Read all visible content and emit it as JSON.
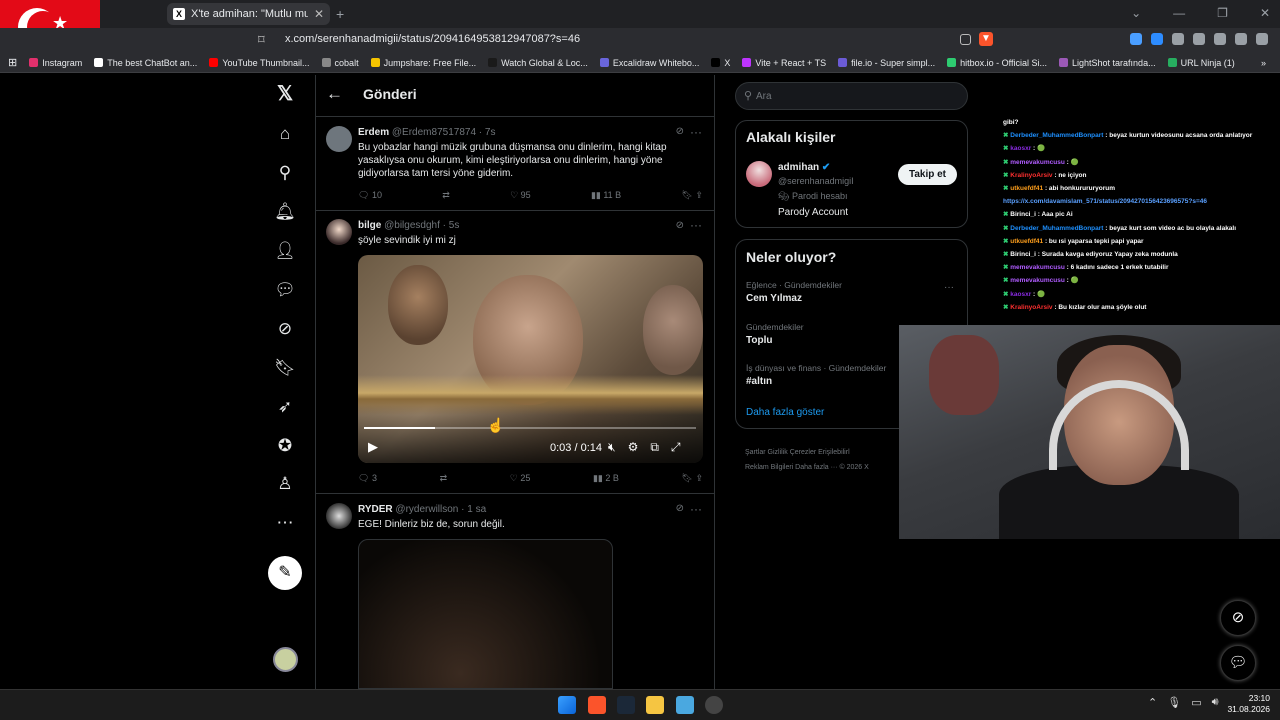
{
  "browser": {
    "tab_title": "X'te admihan: \"Mutlu musunuz i",
    "tab_close": "✕",
    "new_tab": "+",
    "window_controls": [
      "⌄",
      "—",
      "❐",
      "✕"
    ],
    "url": "x.com/serenhanadmigii/status/2094164953812947087?s=46",
    "bookmarks": [
      {
        "label": "Instagram",
        "color": "#e1306c"
      },
      {
        "label": "The best ChatBot an...",
        "color": "#ffffff"
      },
      {
        "label": "YouTube Thumbnail...",
        "color": "#ff0000"
      },
      {
        "label": "cobalt",
        "color": "#888888"
      },
      {
        "label": "Jumpshare: Free File...",
        "color": "#f5c400"
      },
      {
        "label": "Watch Global & Loc...",
        "color": "#1a1a1a"
      },
      {
        "label": "Excalidraw Whitebo...",
        "color": "#6965db"
      },
      {
        "label": "X",
        "color": "#000000"
      },
      {
        "label": "Vite + React + TS",
        "color": "#bd34fe"
      },
      {
        "label": "file.io - Super simpl...",
        "color": "#6b5bd6"
      },
      {
        "label": "hitbox.io - Official Si...",
        "color": "#2ecc71"
      },
      {
        "label": "LightShot tarafında...",
        "color": "#9b59b6"
      },
      {
        "label": "URL Ninja (1)",
        "color": "#27ae60"
      }
    ]
  },
  "header": {
    "back_icon": "←",
    "title": "Gönderi"
  },
  "nav_icons": [
    "x-logo-icon",
    "home-icon",
    "search-icon",
    "notifications-icon",
    "follow-icon",
    "messages-icon",
    "grok-icon",
    "bookmarks-icon",
    "premium-icon",
    "verified-icon",
    "profile-icon",
    "more-icon"
  ],
  "tweets": [
    {
      "name": "Erdem",
      "handle": "@Erdem87517874 · 7s",
      "text": "Bu yobazlar hangi müzik grubuna düşmansa onu dinlerim, hangi kitap yasaklıysa onu okurum, kimi eleştiriyorlarsa onu dinlerim, hangi yöne gidiyorlarsa tam tersi yöne giderim.",
      "replies": "10",
      "reposts": "",
      "likes": "95",
      "views": "11 B"
    },
    {
      "name": "bilge",
      "handle": "@bilgesdghf · 5s",
      "text": "şöyle sevindik iyi mi zj",
      "video": {
        "time": "0:03 / 0:14",
        "progress": 0.214
      },
      "replies": "3",
      "reposts": "",
      "likes": "25",
      "views": "2 B"
    },
    {
      "name": "RYDER",
      "handle": "@ryderwillson · 1 sa",
      "text": "EGE! Dinleriz biz de, sorun değil."
    }
  ],
  "right": {
    "search_placeholder": "Ara",
    "related_title": "Alakalı kişiler",
    "person_name": "admihan",
    "person_handle": "@serenhanadmigiI",
    "parody_label": "Parodi hesabı",
    "parody_account": "Parody Account",
    "follow_label": "Takip et",
    "trends_title": "Neler oluyor?",
    "trends": [
      {
        "category": "Eğlence · Gündemdekiler",
        "name": "Cem Yılmaz"
      },
      {
        "category": "Gündemdekiler",
        "name": "Toplu"
      },
      {
        "category": "İş dünyası ve finans · Gündemdekiler",
        "name": "#altın"
      }
    ],
    "show_more": "Daha fazla göster",
    "footer_line1": "Şartlar    Gizlilik    Çerezler    Erişilebilirl",
    "footer_line2": "Reklam Bilgileri    Daha fazla ···    © 2026 X"
  },
  "chat": [
    {
      "user": "",
      "color": "#ffffff",
      "msg": "gibi?"
    },
    {
      "user": "Derbeder_MuhammedBonpart",
      "color": "#1e90ff",
      "msg": " : beyaz kurtun videosunu acsana orda anlatıyor"
    },
    {
      "user": "kaosxr",
      "color": "#8a2be2",
      "msg": " : 🟢"
    },
    {
      "user": "memevakumcusu",
      "color": "#b05cff",
      "msg": " : 🟢"
    },
    {
      "user": "KralinyoArsiv",
      "color": "#ff3030",
      "msg": " : ne içiyon"
    },
    {
      "user": "utkuefdf41",
      "color": "#ff9f1c",
      "msg": " : abi honkurururyorum"
    },
    {
      "user": "",
      "color": "#5aa0ff",
      "msg": "https://x.com/davamislam_571/status/2094270156423696575?s=46"
    },
    {
      "user": "Birinci_i",
      "color": "#ffffff",
      "msg": " : Aaa pic Ai"
    },
    {
      "user": "Derbeder_MuhammedBonpart",
      "color": "#1e90ff",
      "msg": " : beyaz kurt som video ac bu olayla alakalı"
    },
    {
      "user": "utkuefdf41",
      "color": "#ff9f1c",
      "msg": " : bu ısi yaparsa tepki papi yapar"
    },
    {
      "user": "Birinci_i",
      "color": "#ffffff",
      "msg": " : Surada kavga ediyoruz Yapay zeka modunla"
    },
    {
      "user": "memevakumcusu",
      "color": "#b05cff",
      "msg": " : 6 kadını sadece 1 erkek tutabilir"
    },
    {
      "user": "memevakumcusu",
      "color": "#b05cff",
      "msg": " : 🟢"
    },
    {
      "user": "kaosxr",
      "color": "#8a2be2",
      "msg": " : 🟢"
    },
    {
      "user": "KralinyoArsiv",
      "color": "#ff3030",
      "msg": " : Bu kızlar olur ama şöyle olut"
    }
  ],
  "taskbar": {
    "time": "23:10",
    "date": "31.08.2026"
  }
}
